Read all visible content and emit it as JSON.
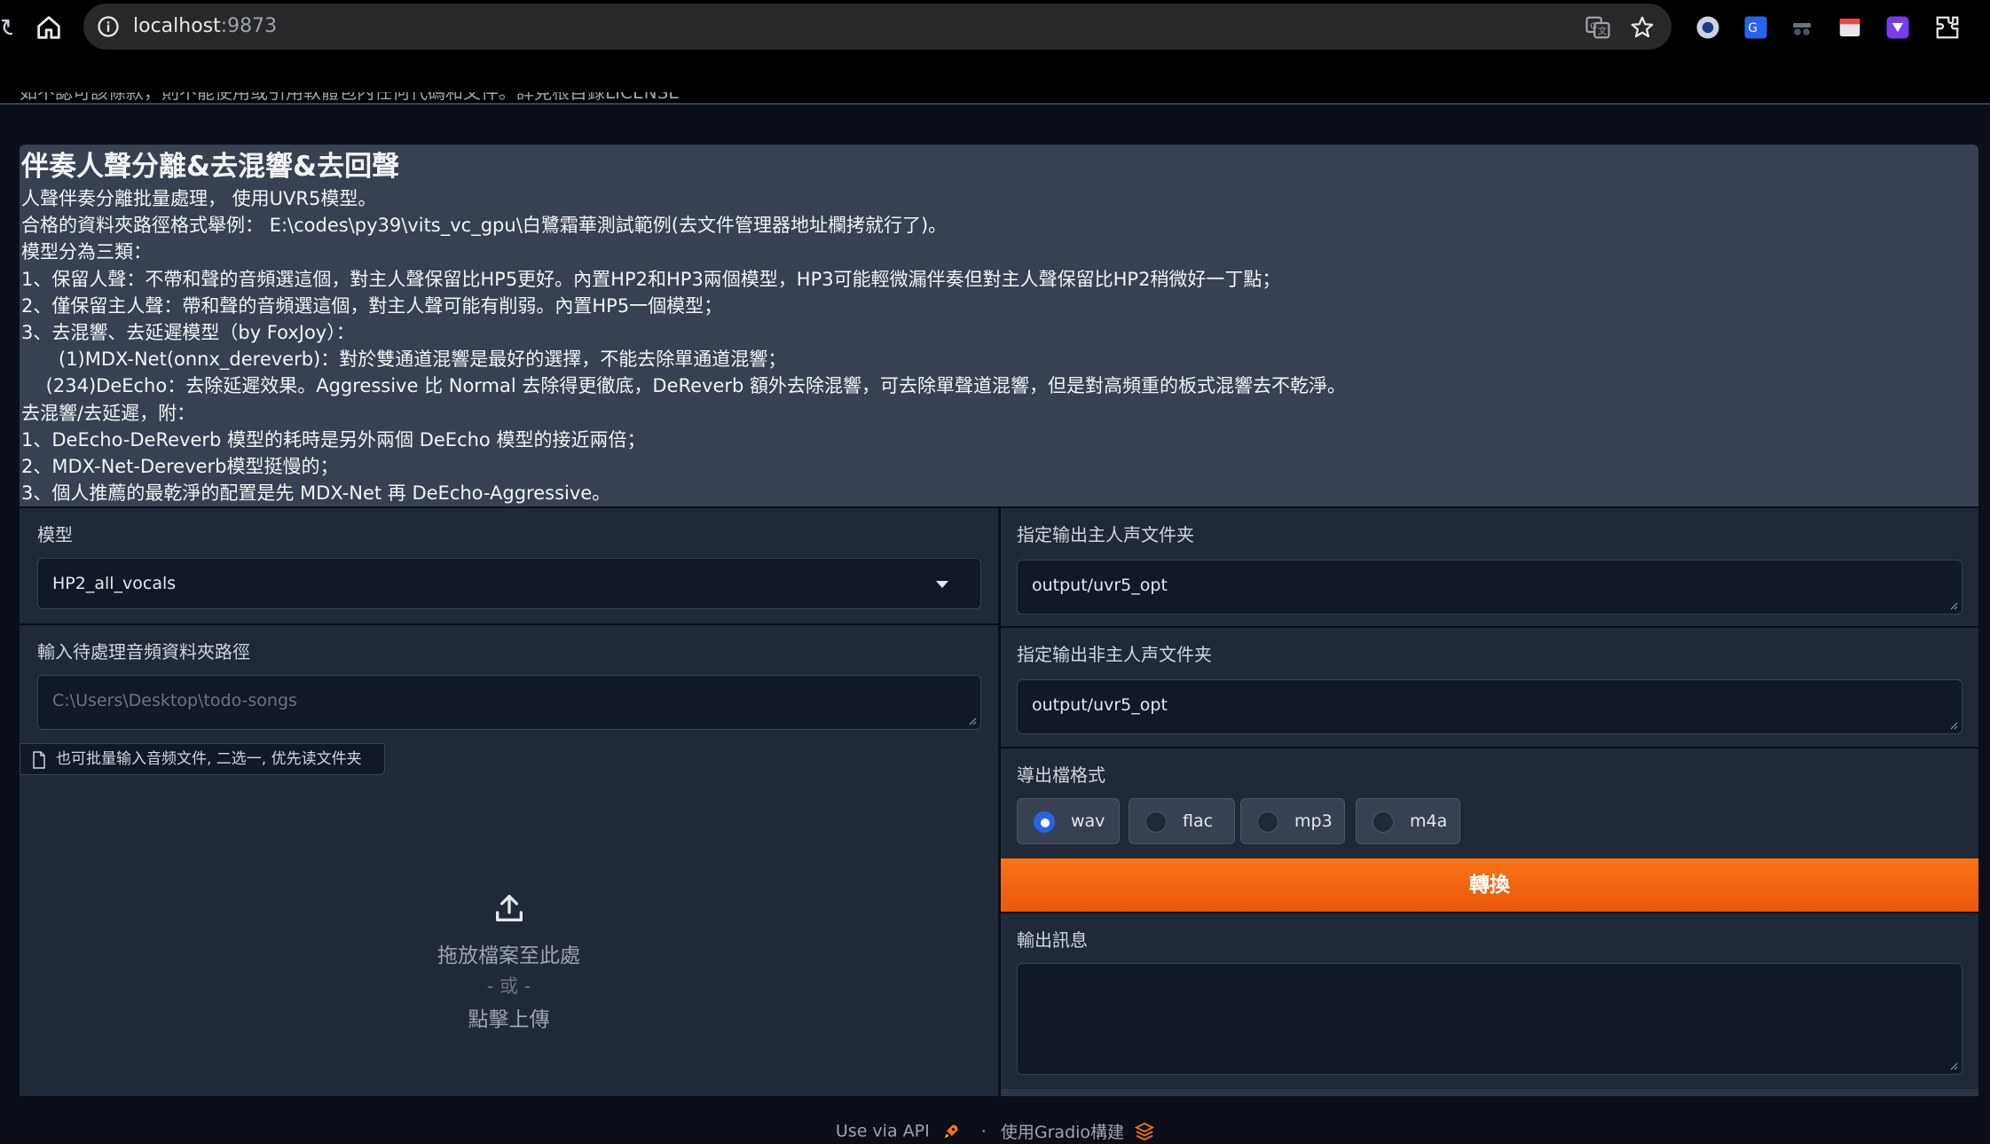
{
  "browser": {
    "url_host": "localhost",
    "url_port": ":9873"
  },
  "clipped_header": "如不認可該條款，則不能使用或引用軟體包內任何代碼和文件。詳見根目錄LICENSE",
  "description": {
    "title": "伴奏人聲分離&去混響&去回聲",
    "lines": [
      "人聲伴奏分離批量處理， 使用UVR5模型。",
      "合格的資料夾路徑格式舉例： E:\\codes\\py39\\vits_vc_gpu\\白鷺霜華測試範例(去文件管理器地址欄拷就行了)。",
      "模型分為三類：",
      "1、保留人聲：不帶和聲的音頻選這個，對主人聲保留比HP5更好。內置HP2和HP3兩個模型，HP3可能輕微漏伴奏但對主人聲保留比HP2稍微好一丁點；",
      "2、僅保留主人聲：帶和聲的音頻選這個，對主人聲可能有削弱。內置HP5一個模型；",
      "3、去混響、去延遲模型（by FoxJoy）：",
      "　　(1)MDX-Net(onnx_dereverb)：對於雙通道混響是最好的選擇，不能去除單通道混響；",
      "　 (234)DeEcho：去除延遲效果。Aggressive 比 Normal 去除得更徹底，DeReverb 額外去除混響，可去除單聲道混響，但是對高頻重的板式混響去不乾淨。",
      "去混響/去延遲，附：",
      "1、DeEcho-DeReverb 模型的耗時是另外兩個 DeEcho 模型的接近兩倍；",
      "2、MDX-Net-Dereverb模型挺慢的；",
      "3、個人推薦的最乾淨的配置是先 MDX-Net 再 DeEcho-Aggressive。"
    ]
  },
  "left": {
    "model_label": "模型",
    "model_value": "HP2_all_vocals",
    "input_dir_label": "輸入待處理音頻資料夾路徑",
    "input_dir_placeholder": "C:\\Users\\Desktop\\todo-songs",
    "file_chip_label": "也可批量输入音频文件, 二选一, 优先读文件夹",
    "upload_text_1": "拖放檔案至此處",
    "upload_text_2": "- 或 -",
    "upload_text_3": "點擊上傳"
  },
  "right": {
    "vocal_out_label": "指定输出主人声文件夹",
    "vocal_out_value": "output/uvr5_opt",
    "ins_out_label": "指定输出非主人声文件夹",
    "ins_out_value": "output/uvr5_opt",
    "format_label": "導出檔格式",
    "formats": [
      "wav",
      "flac",
      "mp3",
      "m4a"
    ],
    "selected_format": "wav",
    "convert_label": "轉換",
    "output_label": "輸出訊息",
    "output_value": ""
  },
  "footer": {
    "api_text": "Use via API",
    "separator": "·",
    "built_with": "使用Gradio構建"
  },
  "colors": {
    "accent": "#f97316",
    "radio_checked": "#2563eb",
    "panel": "#1f2937",
    "desc_bg": "#374151"
  }
}
